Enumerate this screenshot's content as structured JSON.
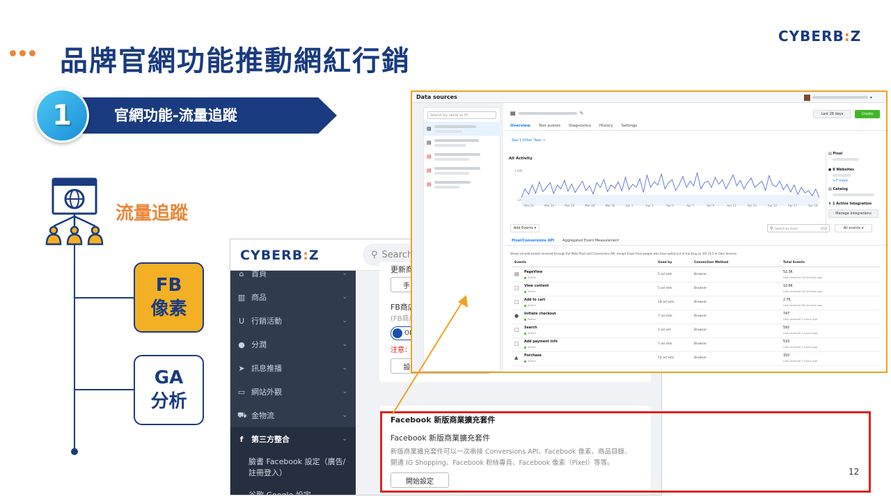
{
  "slide": {
    "title": "品牌官網功能推動網紅行銷",
    "logo_text": "CYBERB",
    "logo_colon": ":",
    "logo_end": "Z",
    "step_number": "1",
    "step_label": "官網功能-流量追蹤",
    "tracking_label": "流量追蹤",
    "tags": [
      {
        "line1": "FB",
        "line2": "像素",
        "color": "#f4b024"
      },
      {
        "line1": "GA",
        "line2": "分析",
        "color": "#ffffff"
      }
    ],
    "page_number": "12",
    "accent_color": "#e8873a",
    "brand_color": "#1a3b7f"
  },
  "admin": {
    "logo_text": "CYBERB",
    "logo_colon": ":",
    "logo_end": "Z",
    "search_placeholder": "Search",
    "sidebar": [
      {
        "icon": "home-icon",
        "glyph": "⌂",
        "label": "首頁"
      },
      {
        "icon": "barcode-icon",
        "glyph": "▥",
        "label": "商品"
      },
      {
        "icon": "magnet-icon",
        "glyph": "U",
        "label": "行銷活動"
      },
      {
        "icon": "user-icon",
        "glyph": "●",
        "label": "分潤"
      },
      {
        "icon": "rocket-icon",
        "glyph": "➤",
        "label": "訊息推播"
      },
      {
        "icon": "monitor-icon",
        "glyph": "▭",
        "label": "網站外觀"
      },
      {
        "icon": "cart-icon",
        "glyph": "⛟",
        "label": "金物流"
      },
      {
        "icon": "facebook-icon",
        "glyph": "f",
        "label": "第三方整合"
      }
    ],
    "sub_items": [
      "臉書 Facebook 設定（廣告/註冊登入）",
      "谷歌 Google 設定"
    ],
    "card1": {
      "heading": "更新商",
      "button1": "手",
      "label": "FB商店",
      "note": "(FB商店",
      "toggle": "ON",
      "warning": "注意：",
      "button2": "設定FB商店 & 即時發佈"
    },
    "card2": {
      "title": "Facebook 新版商業擴充套件",
      "subtitle": "Facebook 新版商業擴充套件",
      "desc1": "新版商業擴充套件可以一次串接 Conversions API、Facebook 像素、商品目錄、",
      "desc2": "開通 IG Shopping、Facebook 粉絲專頁、Facebook 像素（Pixel）等等。",
      "button": "開始設定"
    }
  },
  "datasources": {
    "title": "Data sources",
    "search_placeholder": "Search by name or ID",
    "date_range": "Last 28 days",
    "create_btn": "Create",
    "tabs": [
      "Overview",
      "Test events",
      "Diagnostics",
      "History",
      "Settings"
    ],
    "other_task": "See 1 Other Task →",
    "all_activity": "All Activity",
    "y_max": "1,046",
    "y_min": "120",
    "x_labels": [
      "Mar 22",
      "Mar 24",
      "Mar 26",
      "Mar 28",
      "Mar 30",
      "Apr 1",
      "Apr 3",
      "Apr 5",
      "Apr 7",
      "Apr 9",
      "Apr 11",
      "Apr 13",
      "Apr 15",
      "Apr 17",
      "Apr 19"
    ],
    "side_info": {
      "pixel": "Pixel",
      "websites": "8 Websites",
      "more": "+7 more",
      "catalog": "Catalog",
      "integration": "1 Active Integration",
      "manage": "Manage Integrations"
    },
    "add_events": "Add Events",
    "search_event": "Search by event",
    "count": "0/50",
    "all_events": "All events",
    "subtabs": [
      "Pixel/Conversions API",
      "Aggregated Event Measurement"
    ],
    "notice": "Shows all web events received through the Meta Pixel and Conversions API, except those from people who have opted out of tracking on iOS 14.5 or later devices.",
    "columns": [
      "Events",
      "Used by",
      "Connection Method",
      "Total Events"
    ],
    "status_label": "Active",
    "rows": [
      {
        "event": "PageView",
        "used": "5 ad sets",
        "method": "Browser",
        "total": "52.3K",
        "time": "Last received 16 minutes ago"
      },
      {
        "event": "View content",
        "used": "5 ad sets",
        "method": "Browser",
        "total": "10.6K",
        "time": "Last received 18 minutes ago"
      },
      {
        "event": "Add to cart",
        "used": "18 ad sets",
        "method": "Browser",
        "total": "2.7K",
        "time": "Last received 46 minutes ago"
      },
      {
        "event": "Initiate checkout",
        "used": "7 ad sets",
        "method": "Browser",
        "total": "747",
        "time": "Last received 2 hours ago"
      },
      {
        "event": "Search",
        "used": "1 ad set",
        "method": "Browser",
        "total": "592",
        "time": "Last received 2 hours ago"
      },
      {
        "event": "Add payment info",
        "used": "7 ad sets",
        "method": "Browser",
        "total": "533",
        "time": "Last received 3 hours ago"
      },
      {
        "event": "Purchase",
        "used": "14 ad sets",
        "method": "Browser",
        "total": "310",
        "time": "Last received 3 hours ago"
      }
    ],
    "activity_series": [
      300,
      520,
      380,
      620,
      410,
      700,
      450,
      560,
      680,
      400,
      620,
      520,
      740,
      460,
      650,
      430,
      580,
      720,
      480,
      600,
      390,
      680,
      560,
      760,
      450,
      620,
      540,
      700,
      470,
      820,
      500,
      640,
      560,
      780,
      430,
      880,
      560,
      700,
      620,
      900,
      520,
      680,
      760,
      480,
      640,
      840,
      560,
      720,
      600,
      940,
      520,
      680,
      720,
      560,
      820,
      640,
      760,
      520,
      700,
      880,
      600,
      740,
      520,
      680,
      800,
      560,
      640,
      720,
      480,
      860,
      620,
      580,
      720,
      500,
      640,
      440,
      620,
      380,
      560,
      420,
      480,
      350,
      520,
      300
    ]
  }
}
